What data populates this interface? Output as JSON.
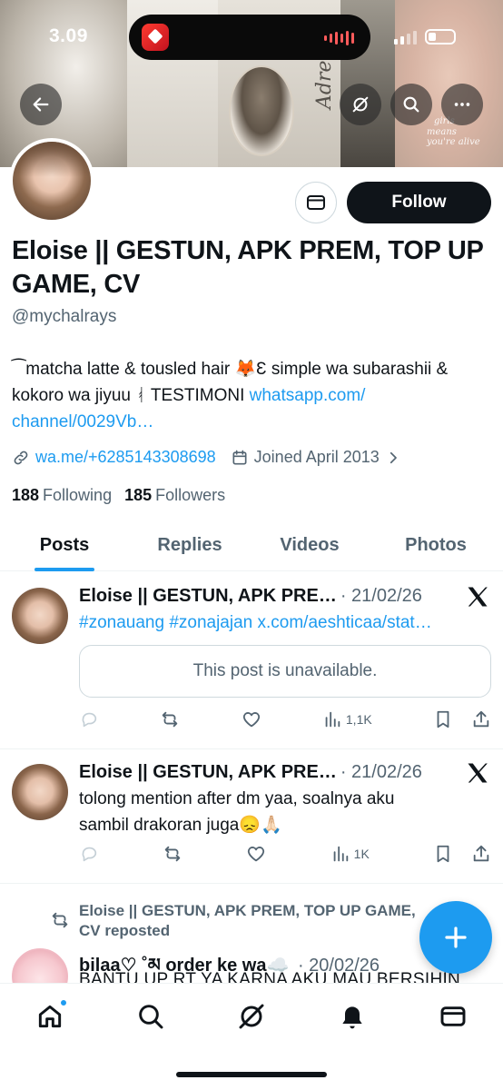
{
  "status_bar": {
    "time": "3.09"
  },
  "banner": {
    "script_words": [
      "Adrena",
      "girls",
      "means you're alive"
    ]
  },
  "profile": {
    "display_name": "Eloise || GESTUN, APK PREM, TOP UP GAME, CV",
    "handle": "@mychalrays",
    "bio_text": "⁀matcha latte & tousled hair 🦊Ɛ simple wa subarashii & kokoro wa jiyuu ᚮ TESTIMONI ",
    "bio_link": "whatsapp.com/ channel/0029Vb…",
    "website": "wa.me/+6285143308698",
    "joined": "Joined April 2013",
    "following_count": "188",
    "following_label": "Following",
    "followers_count": "185",
    "followers_label": "Followers",
    "follow_label": "Follow"
  },
  "tabs": [
    {
      "label": "Posts",
      "active": true
    },
    {
      "label": "Replies",
      "active": false
    },
    {
      "label": "Videos",
      "active": false
    },
    {
      "label": "Photos",
      "active": false
    }
  ],
  "posts": [
    {
      "name": "Eloise || GESTUN, APK PRE…",
      "date": "· 21/02/26",
      "text": "#zonauang #zonajajan x.com/aeshticaa/stat…",
      "quoted": "This post is unavailable.",
      "views": "1,1K"
    },
    {
      "name": "Eloise || GESTUN, APK PRE…",
      "date": "· 21/02/26",
      "text": "tolong mention after dm yaa, soalnya aku sambil drakoran juga😞🙏🏻",
      "views": "1K"
    },
    {
      "repost_label": "Eloise || GESTUN, APK PREM, TOP UP GAME, CV reposted",
      "name": "bilaa♡ ˚མ order ke wa☁️",
      "date": "· 20/02/26",
      "text": "BANTU UP RT YA KARNA AKU MAU BERSIHIN"
    }
  ],
  "colors": {
    "accent": "#1d9bf0",
    "text": "#0f1419",
    "secondary": "#536471",
    "border": "#cfd9de"
  }
}
